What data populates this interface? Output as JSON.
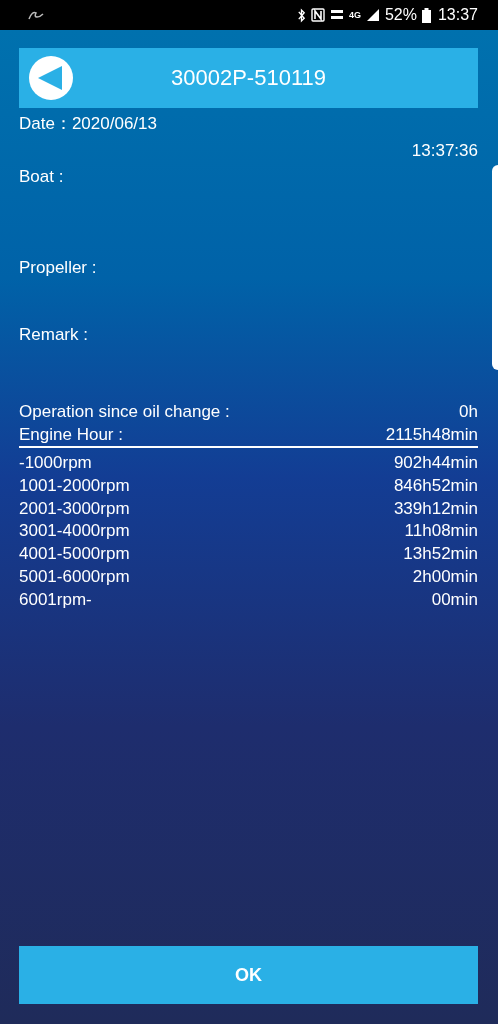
{
  "status_bar": {
    "network": "4G",
    "battery": "52%",
    "time": "13:37"
  },
  "header": {
    "title": "30002P-510119"
  },
  "date": "Date：2020/06/13",
  "time": "13:37:36",
  "fields": [
    {
      "label": "Boat :"
    },
    {
      "label": "Propeller :"
    },
    {
      "label": "Remark :"
    }
  ],
  "summary": [
    {
      "label": "Operation since oil change :",
      "value": "0h",
      "underlined": false
    },
    {
      "label": "Engine Hour :",
      "value": "2115h48min",
      "underlined": true
    }
  ],
  "rpm_rows": [
    {
      "range": "-1000rpm",
      "value": "902h44min"
    },
    {
      "range": "1001-2000rpm",
      "value": "846h52min"
    },
    {
      "range": "2001-3000rpm",
      "value": "339h12min"
    },
    {
      "range": "3001-4000rpm",
      "value": "11h08min"
    },
    {
      "range": "4001-5000rpm",
      "value": "13h52min"
    },
    {
      "range": "5001-6000rpm",
      "value": "2h00min"
    },
    {
      "range": "6001rpm-",
      "value": "00min"
    }
  ],
  "ok_button": "OK"
}
